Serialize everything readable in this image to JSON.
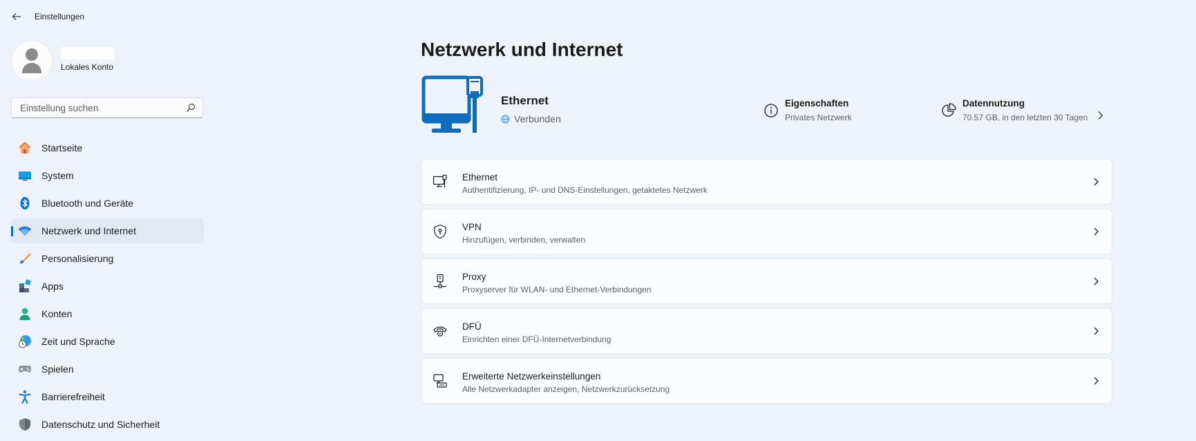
{
  "app": {
    "title": "Einstellungen"
  },
  "profile": {
    "account_type": "Lokales Konto"
  },
  "search": {
    "placeholder": "Einstellung suchen"
  },
  "sidebar": {
    "items": [
      {
        "label": "Startseite",
        "icon": "home-icon"
      },
      {
        "label": "System",
        "icon": "monitor-icon"
      },
      {
        "label": "Bluetooth und Geräte",
        "icon": "bluetooth-icon"
      },
      {
        "label": "Netzwerk und Internet",
        "icon": "wifi-icon",
        "active": true
      },
      {
        "label": "Personalisierung",
        "icon": "brush-icon"
      },
      {
        "label": "Apps",
        "icon": "apps-icon"
      },
      {
        "label": "Konten",
        "icon": "person-icon"
      },
      {
        "label": "Zeit und Sprache",
        "icon": "globe-clock-icon"
      },
      {
        "label": "Spielen",
        "icon": "gamepad-icon"
      },
      {
        "label": "Barrierefreiheit",
        "icon": "accessibility-icon"
      },
      {
        "label": "Datenschutz und Sicherheit",
        "icon": "shield-icon"
      }
    ]
  },
  "main": {
    "title": "Netzwerk und Internet",
    "hero": {
      "name": "Ethernet",
      "status": "Verbunden",
      "properties": {
        "title": "Eigenschaften",
        "subtitle": "Privates Netzwerk"
      },
      "data_usage": {
        "title": "Datennutzung",
        "subtitle": "70.57 GB, in den letzten 30 Tagen"
      }
    },
    "cards": [
      {
        "title": "Ethernet",
        "subtitle": "Authentifizierung, IP- und DNS-Einstellungen, getaktetes Netzwerk",
        "icon": "ethernet-icon"
      },
      {
        "title": "VPN",
        "subtitle": "Hinzufügen, verbinden, verwalten",
        "icon": "vpn-shield-icon"
      },
      {
        "title": "Proxy",
        "subtitle": "Proxyserver für WLAN- und Ethernet-Verbindungen",
        "icon": "proxy-icon"
      },
      {
        "title": "DFÜ",
        "subtitle": "Einrichten einer DFÜ-Internetverbindung",
        "icon": "dialup-phone-icon"
      },
      {
        "title": "Erweiterte Netzwerkeinstellungen",
        "subtitle": "Alle Netzwerkadapter anzeigen, Netzwerkzurücksetzung",
        "icon": "network-adapter-icon"
      }
    ]
  },
  "colors": {
    "accent": "#0067c0",
    "background": "#eef3f9",
    "card": "#fbfcfd"
  }
}
